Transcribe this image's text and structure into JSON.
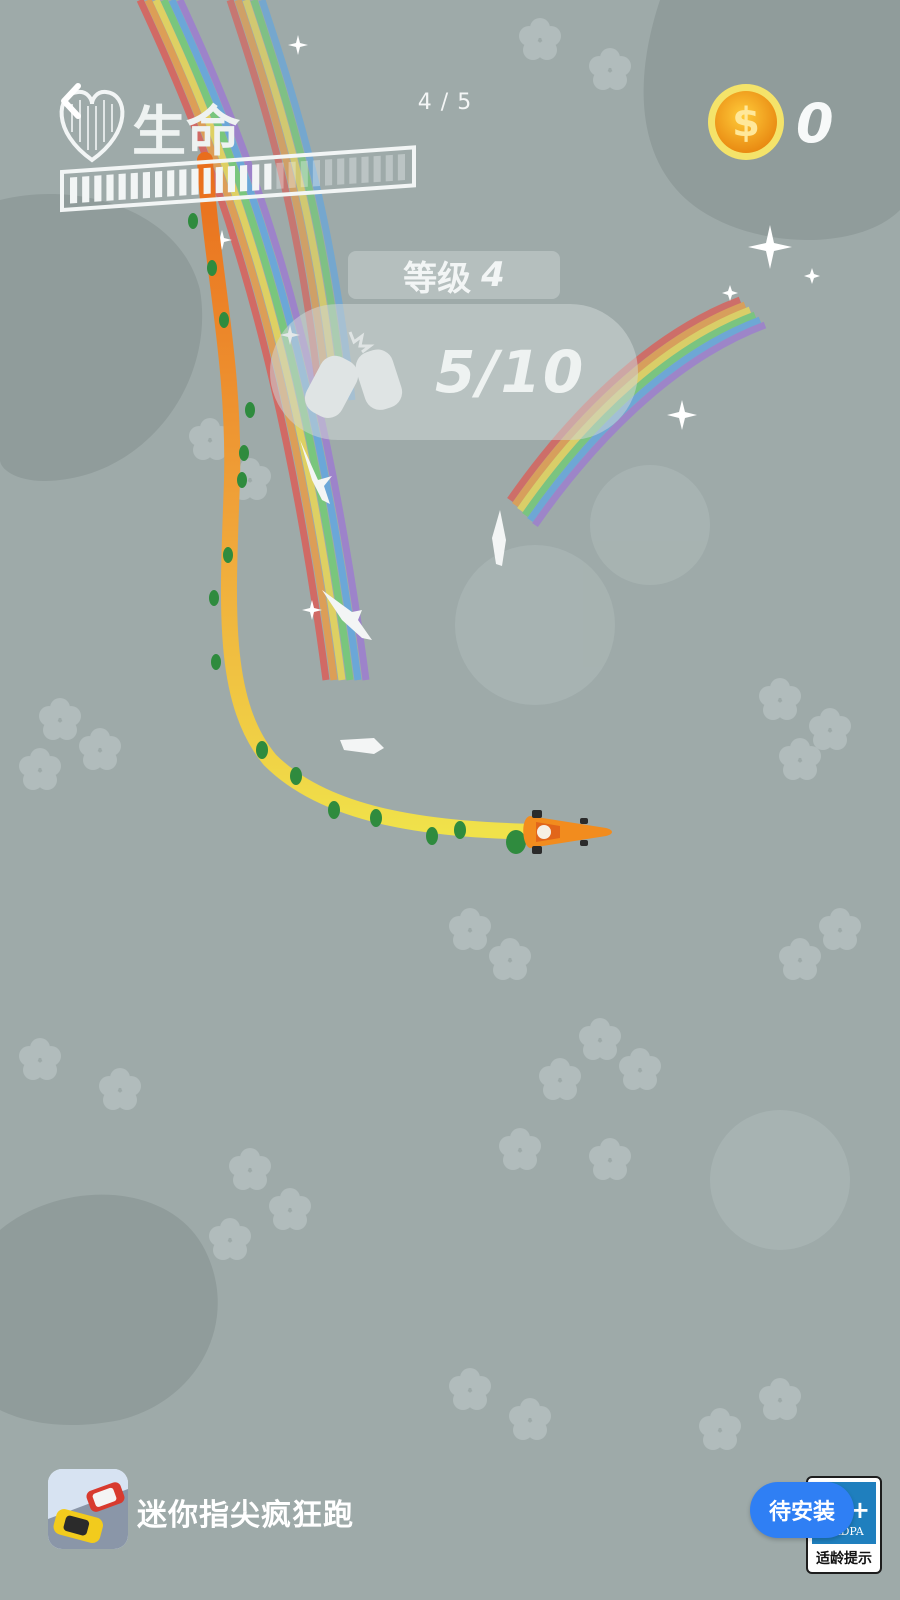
{
  "hud": {
    "life_label": "生命",
    "life_fraction": 0.6,
    "page_counter": "4 / 5",
    "coin_count": "0",
    "level_label": "等级",
    "level_number": "4",
    "crash_progress": "5/10"
  },
  "icons": {
    "back": "chevron-left-icon",
    "heart": "heart-icon",
    "coin": "dollar-coin-icon",
    "crashed_cars": "crashed-cars-icon"
  },
  "ad": {
    "app_name": "迷你指尖疯狂跑",
    "install_label": "待安装",
    "rating_age": "12+",
    "rating_brand": "CADPA",
    "rating_caption": "适龄提示"
  },
  "colors": {
    "background": "#9eaaa9",
    "trail_start": "#e96d1c",
    "trail_end": "#f0e24a",
    "coin": "#f3a21b",
    "install_button": "#2f7ff4"
  }
}
